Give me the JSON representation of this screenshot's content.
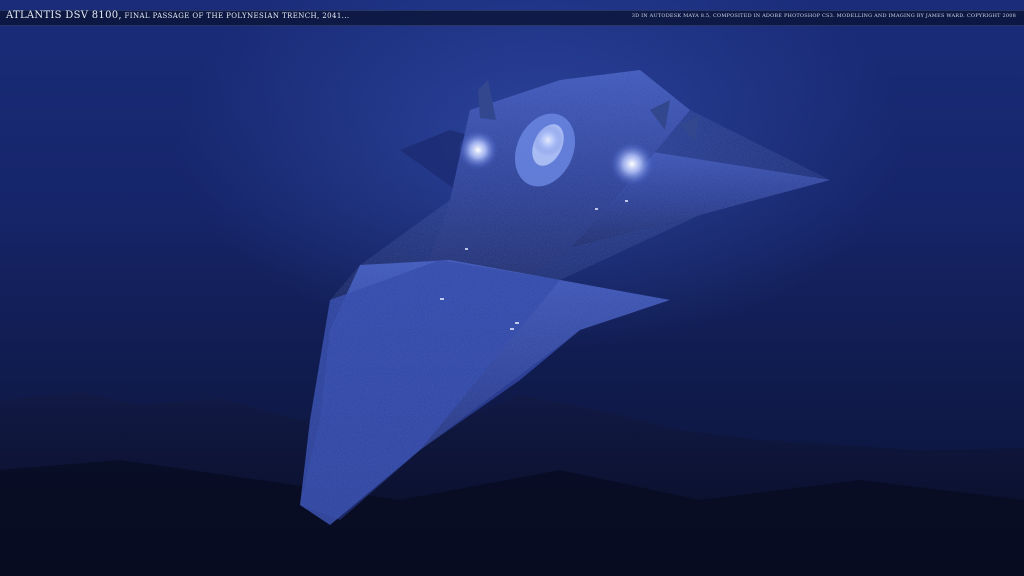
{
  "caption": {
    "title_main": "ATLANTIS DSV 8100,",
    "title_sub": " final passage of the polynesian trench, 2041...",
    "credits": "3D in Autodesk Maya 8.5, composited in Adobe Photoshop CS3. Modelling and imaging by James Ward.   Copyright 2008"
  },
  "colors": {
    "water_top": "#1a2c7a",
    "water_bottom": "#0b1233",
    "hull": "#2a3f9a",
    "hull_highlight": "#5c78d6",
    "light_glow": "#dfe8ff"
  }
}
